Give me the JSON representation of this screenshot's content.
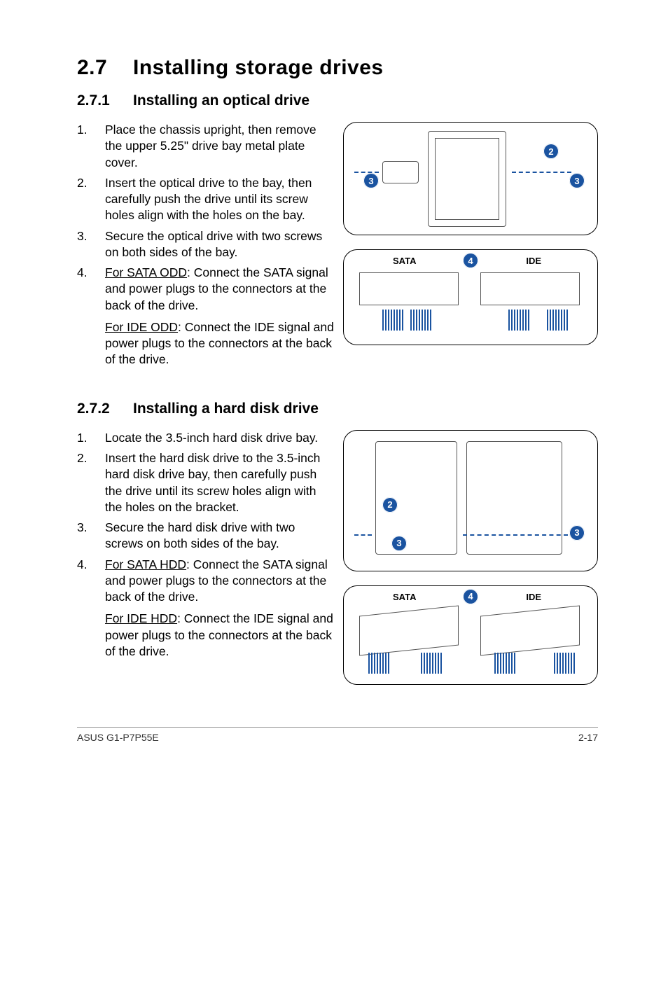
{
  "section": {
    "number": "2.7",
    "title": "Installing storage drives"
  },
  "sub1": {
    "number": "2.7.1",
    "title": "Installing an optical drive",
    "steps": [
      {
        "n": "1.",
        "t": "Place the chassis upright, then remove the upper 5.25\" drive bay metal plate cover."
      },
      {
        "n": "2.",
        "t": "Insert the optical drive to the bay, then carefully push the drive until its screw holes align with the holes on the bay."
      },
      {
        "n": "3.",
        "t": "Secure the optical drive with two screws on both sides of the bay."
      },
      {
        "n": "4.",
        "lead": "For SATA ODD",
        "t": ": Connect the SATA signal and power plugs to the connectors at the back of the drive.",
        "lead2": "For IDE ODD",
        "t2": ": Connect the IDE signal and power plugs to the connectors at the back of the drive."
      }
    ],
    "fig1": {
      "b2": "2",
      "b3l": "3",
      "b3r": "3"
    },
    "fig2": {
      "sata": "SATA",
      "ide": "IDE",
      "b4": "4"
    }
  },
  "sub2": {
    "number": "2.7.2",
    "title": "Installing a hard disk drive",
    "steps": [
      {
        "n": "1.",
        "t": "Locate the 3.5-inch hard disk drive bay."
      },
      {
        "n": "2.",
        "t": "Insert the hard disk drive to the 3.5-inch hard disk drive bay, then carefully push the drive until its screw holes align with the holes on the bracket."
      },
      {
        "n": "3.",
        "t": "Secure the hard disk drive with two screws on both sides of the bay."
      },
      {
        "n": "4.",
        "lead": "For SATA HDD",
        "t": ": Connect the SATA signal and power plugs to the connectors at the back of the drive.",
        "lead2": "For IDE HDD",
        "t2": ": Connect the IDE signal and power plugs to the connectors at the back of the drive."
      }
    ],
    "fig1": {
      "b2": "2",
      "b3l": "3",
      "b3r": "3"
    },
    "fig2": {
      "sata": "SATA",
      "ide": "IDE",
      "b4": "4"
    }
  },
  "footer": {
    "left": "ASUS G1-P7P55E",
    "right": "2-17"
  }
}
